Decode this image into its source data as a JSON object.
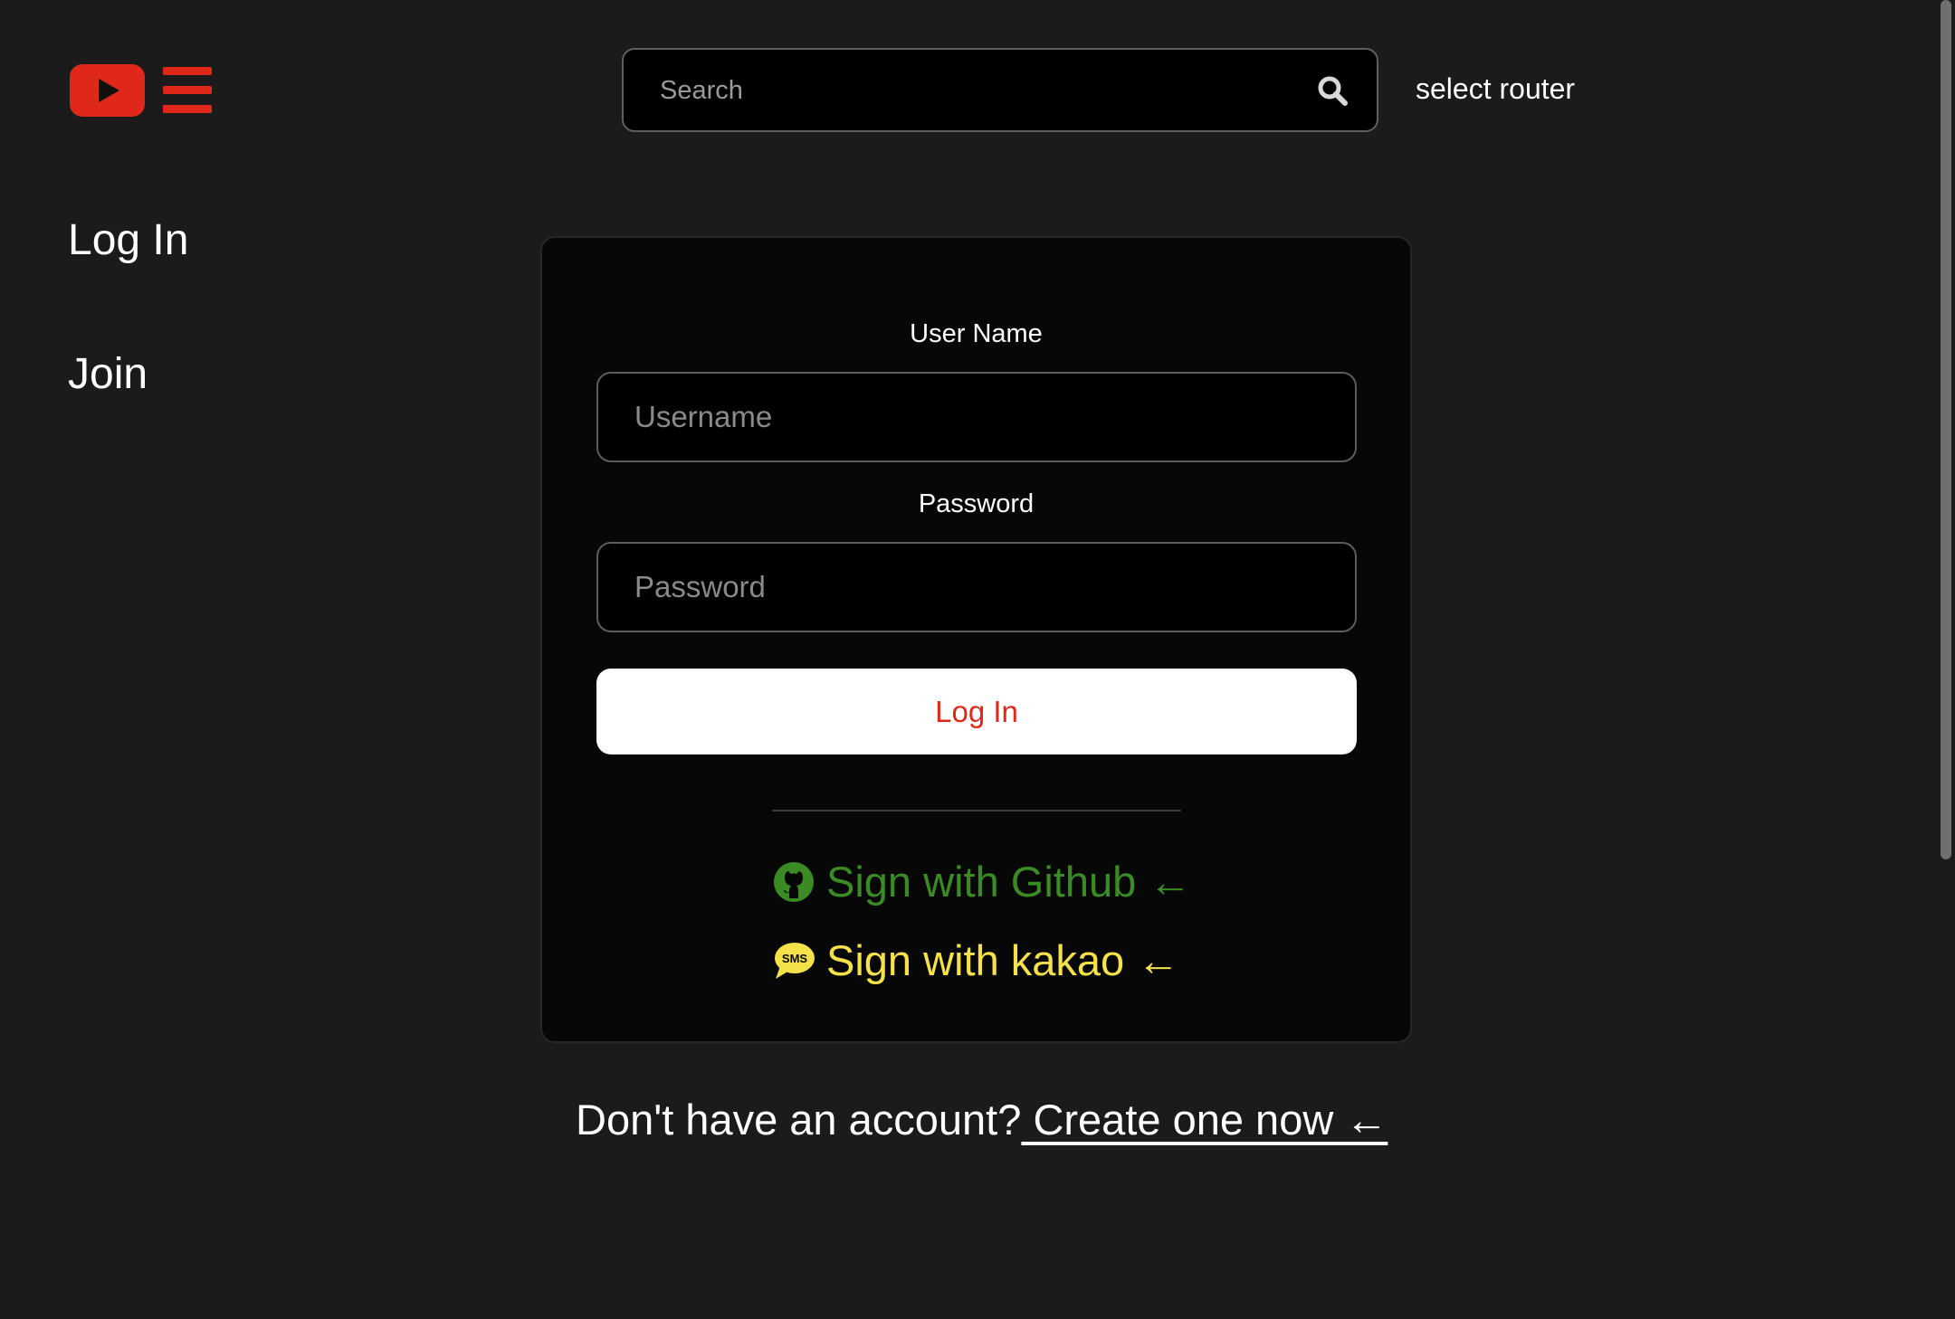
{
  "header": {
    "logo_icon": "youtube-play-icon",
    "menu_icon": "hamburger-menu-icon",
    "search": {
      "placeholder": "Search",
      "value": "",
      "icon": "search-icon"
    },
    "router_label": "select router"
  },
  "sidebar": {
    "items": [
      {
        "label": "Log In"
      },
      {
        "label": "Join"
      }
    ]
  },
  "login_form": {
    "username_label": "User Name",
    "username_placeholder": "Username",
    "password_label": "Password",
    "password_placeholder": "Password",
    "submit_label": "Log In",
    "social": [
      {
        "label": "Sign with Github",
        "arrow": "←",
        "icon": "github-icon",
        "color": "#3a8b24"
      },
      {
        "label": "Sign with kakao",
        "arrow": "←",
        "icon": "sms-chat-icon",
        "color": "#f5e14a"
      }
    ]
  },
  "footer": {
    "prompt": "Don't have an account?",
    "link_label": " Create one now ←"
  },
  "colors": {
    "background": "#1b1b1c",
    "accent": "#e0281a",
    "card": "#070707"
  }
}
